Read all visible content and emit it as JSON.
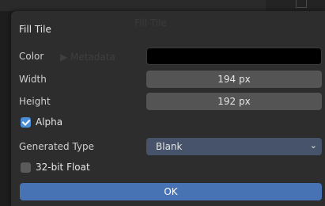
{
  "background": {
    "ghost_title": "Fill Tile",
    "ghost_metadata": "▶ Metadata"
  },
  "dialog": {
    "title": "Fill Tile",
    "color": {
      "label": "Color",
      "value": "#000000"
    },
    "width": {
      "label": "Width",
      "value": "194 px"
    },
    "height": {
      "label": "Height",
      "value": "192 px"
    },
    "alpha": {
      "label": "Alpha",
      "checked": true
    },
    "generated_type": {
      "label": "Generated Type",
      "value": "Blank",
      "icon": "chevron-down-icon"
    },
    "float32": {
      "label": "32-bit Float",
      "checked": false
    },
    "ok_label": "OK"
  },
  "colors": {
    "dialog_bg": "#2d2d2d",
    "field_bg": "#545454",
    "select_bg": "#46536a",
    "ok_bg": "#4772b3",
    "checkbox_on": "#4a8ed8"
  }
}
